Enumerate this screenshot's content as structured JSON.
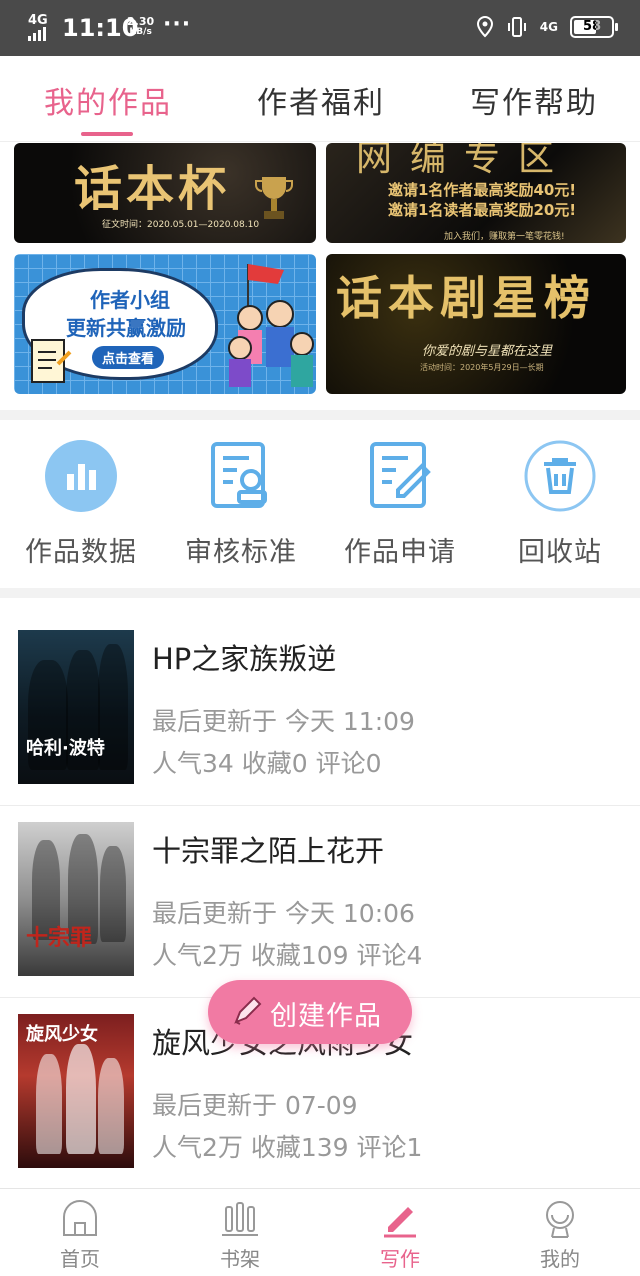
{
  "status_bar": {
    "network": "4G",
    "time": "11:10",
    "speed_value": "2.30",
    "speed_unit": "KB/s",
    "more": "···",
    "network_right": "4G",
    "battery": "58"
  },
  "tabs": [
    {
      "label": "我的作品",
      "active": true
    },
    {
      "label": "作者福利",
      "active": false
    },
    {
      "label": "写作帮助",
      "active": false
    }
  ],
  "banners": {
    "b1": {
      "title": "话本杯",
      "date": "征文时间：2020.05.01—2020.08.10"
    },
    "b2": {
      "title": "网编专区",
      "line1": "邀请1名作者最高奖励40元!",
      "line2": "邀请1名读者最高奖励20元!",
      "small": "加入我们，赚取第一笔零花钱!"
    },
    "b3": {
      "line1": "作者小组",
      "line2": "更新共赢激励",
      "button": "点击查看"
    },
    "b4": {
      "title": "话本剧星榜",
      "subtitle": "你爱的剧与星都在这里",
      "small": "活动时间：2020年5月29日—长期"
    }
  },
  "tools": [
    {
      "label": "作品数据",
      "icon": "bar-chart-icon"
    },
    {
      "label": "审核标准",
      "icon": "review-standard-icon"
    },
    {
      "label": "作品申请",
      "icon": "edit-document-icon"
    },
    {
      "label": "回收站",
      "icon": "trash-icon"
    }
  ],
  "works": [
    {
      "title": "HP之家族叛逆",
      "updated": "最后更新于 今天 11:09",
      "stats": "人气34 收藏0 评论0",
      "cover_text": "哈利·波特"
    },
    {
      "title": "十宗罪之陌上花开",
      "updated": "最后更新于 今天 10:06",
      "stats": "人气2万 收藏109 评论4",
      "cover_text": "十宗罪"
    },
    {
      "title": "旋风少女之风雨少女",
      "updated": "最后更新于 07-09",
      "stats": "人气2万 收藏139 评论1",
      "cover_text": "旋风少女"
    }
  ],
  "fab": {
    "label": "创建作品"
  },
  "bottom_nav": [
    {
      "label": "首页",
      "icon": "home-icon",
      "active": false
    },
    {
      "label": "书架",
      "icon": "bookshelf-icon",
      "active": false
    },
    {
      "label": "写作",
      "icon": "pen-icon",
      "active": true
    },
    {
      "label": "我的",
      "icon": "profile-icon",
      "active": false
    }
  ],
  "colors": {
    "accent": "#e8638c",
    "fab": "#f17aa3",
    "tool_icon": "#5eaee8"
  }
}
